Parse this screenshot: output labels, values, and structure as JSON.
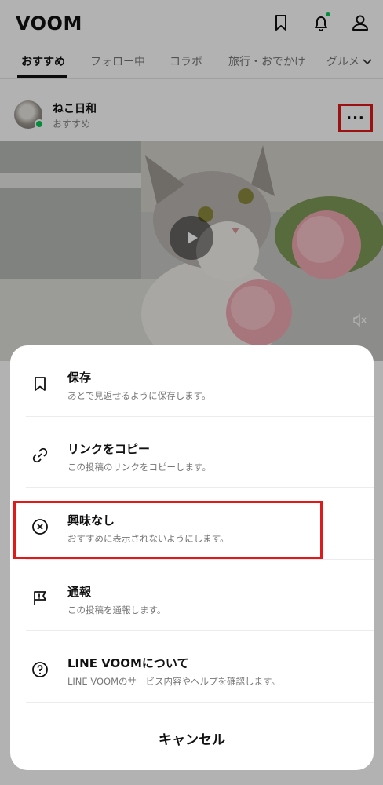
{
  "header": {
    "logo": "VOOM",
    "icons": [
      "bookmark-icon",
      "bell-icon",
      "profile-icon"
    ],
    "notification_dot_color": "#06c755"
  },
  "tabs": [
    {
      "label": "おすすめ",
      "active": true
    },
    {
      "label": "フォロー中",
      "active": false
    },
    {
      "label": "コラボ",
      "active": false
    },
    {
      "label": "旅行・おでかけ",
      "active": false
    },
    {
      "label": "グルメ",
      "active": false
    }
  ],
  "post": {
    "author": "ねこ日和",
    "source": "おすすめ",
    "more_label": "···"
  },
  "sheet": {
    "items": [
      {
        "title": "保存",
        "desc": "あとで見返せるように保存します。",
        "icon": "bookmark-icon"
      },
      {
        "title": "リンクをコピー",
        "desc": "この投稿のリンクをコピーします。",
        "icon": "link-icon"
      },
      {
        "title": "興味なし",
        "desc": "おすすめに表示されないようにします。",
        "icon": "x-circle-icon"
      },
      {
        "title": "通報",
        "desc": "この投稿を通報します。",
        "icon": "report-flag-icon"
      },
      {
        "title": "LINE VOOMについて",
        "desc": "LINE VOOMのサービス内容やヘルプを確認します。",
        "icon": "help-circle-icon"
      }
    ],
    "cancel_label": "キャンセル"
  },
  "colors": {
    "highlight": "#e0191b",
    "accent": "#06c755"
  }
}
